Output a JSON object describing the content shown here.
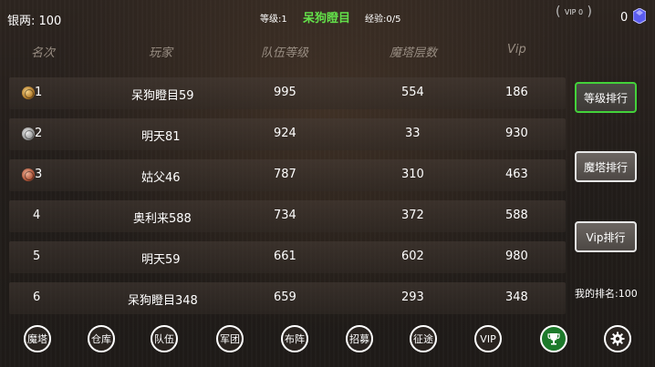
{
  "topbar": {
    "silver": "银两: 100",
    "level": "等级:1",
    "player_name": "呆狗瞪目",
    "exp": "经验:0/5",
    "vip": "VIP 0",
    "gems": "0"
  },
  "table": {
    "headers": [
      "名次",
      "玩家",
      "队伍等级",
      "魔塔层数",
      "Vip"
    ],
    "rows": [
      {
        "rank": "1",
        "player": "呆狗瞪目59",
        "team_level": "995",
        "tower": "554",
        "vip": "186",
        "medal": "gold"
      },
      {
        "rank": "2",
        "player": "明天81",
        "team_level": "924",
        "tower": "33",
        "vip": "930",
        "medal": "silver"
      },
      {
        "rank": "3",
        "player": "姑父46",
        "team_level": "787",
        "tower": "310",
        "vip": "463",
        "medal": "bronze"
      },
      {
        "rank": "4",
        "player": "奥利来588",
        "team_level": "734",
        "tower": "372",
        "vip": "588",
        "medal": ""
      },
      {
        "rank": "5",
        "player": "明天59",
        "team_level": "661",
        "tower": "602",
        "vip": "980",
        "medal": ""
      },
      {
        "rank": "6",
        "player": "呆狗瞪目348",
        "team_level": "659",
        "tower": "293",
        "vip": "348",
        "medal": ""
      }
    ]
  },
  "side": {
    "level_rank": "等级排行",
    "tower_rank": "魔塔排行",
    "vip_rank": "Vip排行",
    "my_rank": "我的排名:100"
  },
  "bottom": {
    "tower": "魔塔",
    "warehouse": "仓库",
    "team": "队伍",
    "legion": "军团",
    "formation": "布阵",
    "recruit": "招募",
    "expedition": "征途",
    "vip": "VIP"
  },
  "colors": {
    "accent_green": "#43d23a",
    "name_green": "#63e04a"
  }
}
